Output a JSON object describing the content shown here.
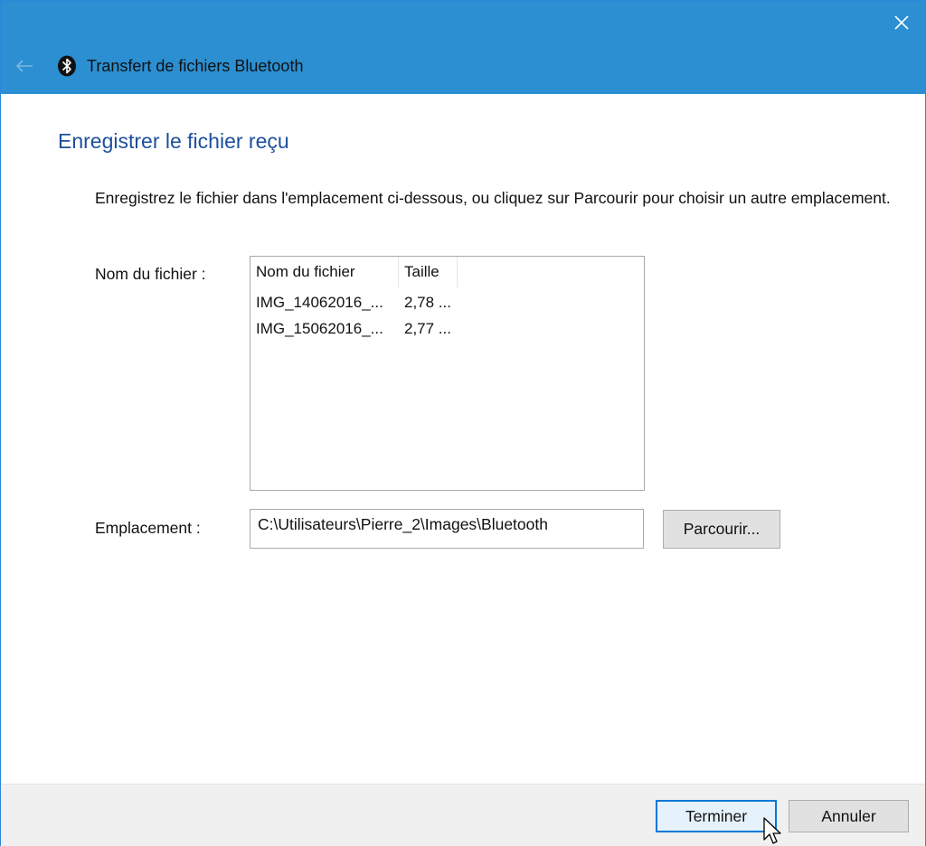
{
  "window": {
    "title": "Transfert de fichiers Bluetooth",
    "titlebar_color": "#2b8fd2",
    "icons": {
      "close": "close-icon",
      "back": "back-arrow-icon",
      "app": "bluetooth-icon"
    }
  },
  "main": {
    "heading": "Enregistrer le fichier reçu",
    "instructions": "Enregistrez le fichier dans l'emplacement ci-dessous, ou cliquez sur Parcourir pour choisir un autre emplacement.",
    "filename_label": "Nom du fichier :",
    "location_label": "Emplacement :",
    "heading_color": "#1e4f9c"
  },
  "file_list": {
    "columns": [
      "Nom du fichier",
      "Taille"
    ],
    "rows": [
      {
        "name": "IMG_14062016_...",
        "size": "2,78 ..."
      },
      {
        "name": "IMG_15062016_...",
        "size": "2,77 ..."
      }
    ]
  },
  "location": {
    "value": "C:\\Utilisateurs\\Pierre_2\\Images\\Bluetooth"
  },
  "buttons": {
    "browse": "Parcourir...",
    "finish": "Terminer",
    "cancel": "Annuler"
  }
}
